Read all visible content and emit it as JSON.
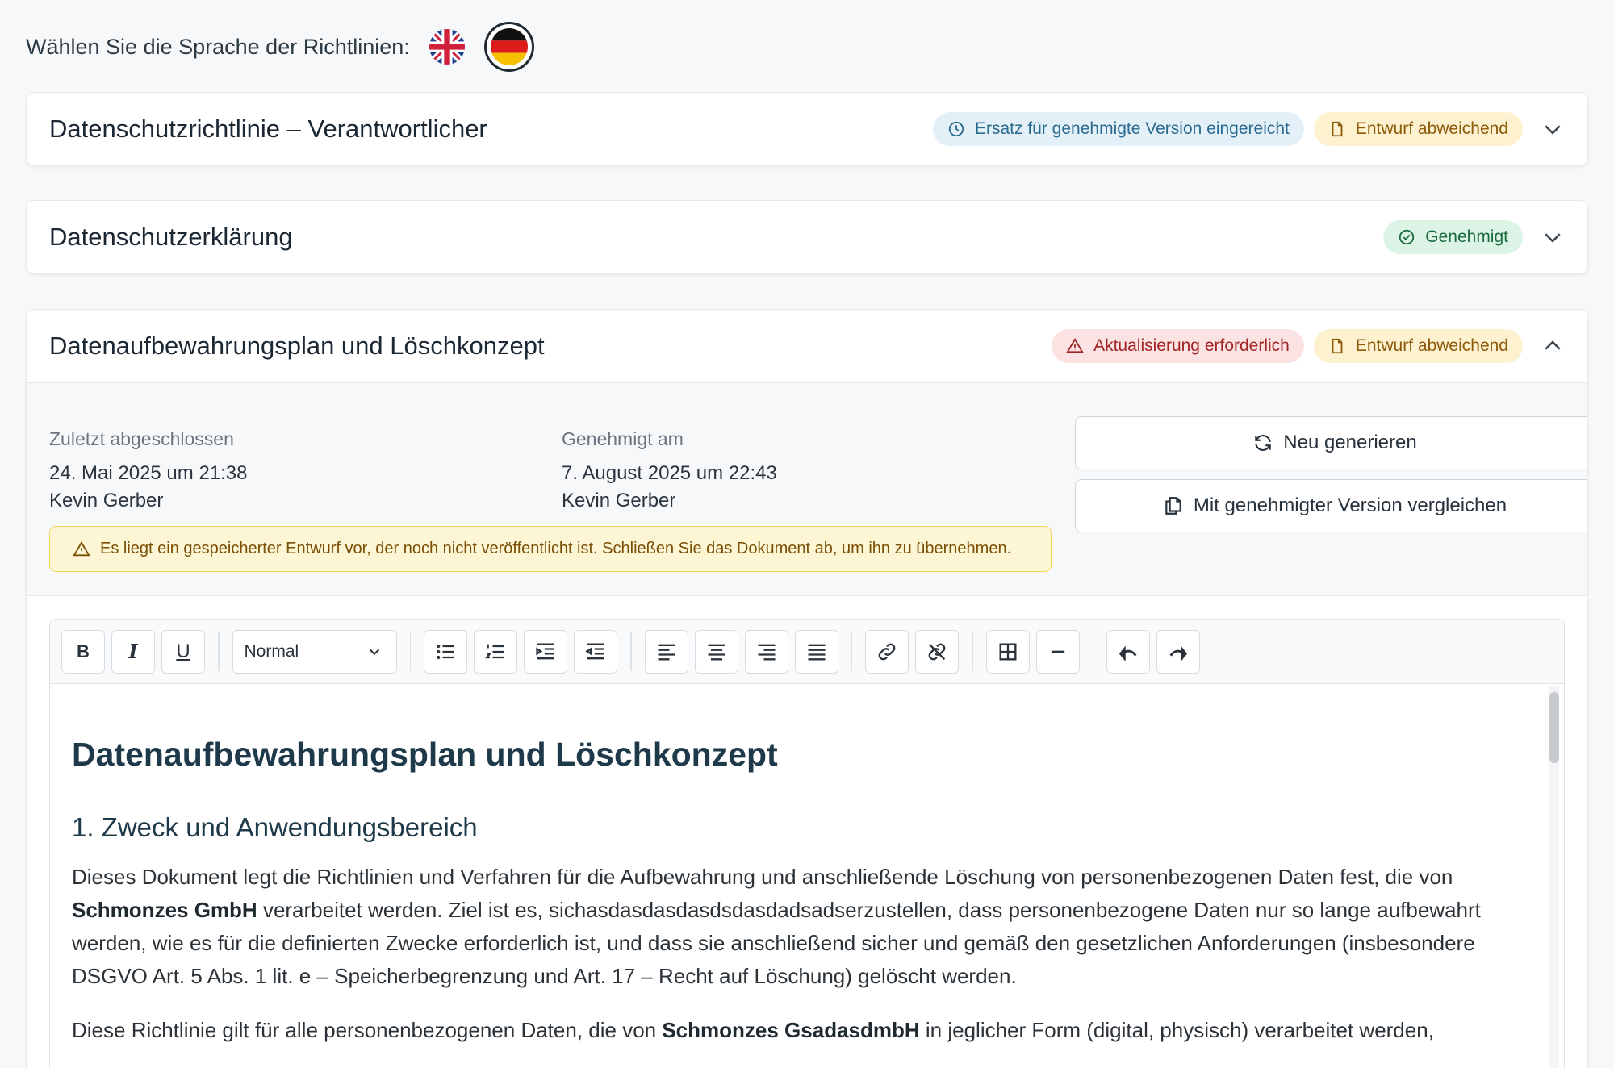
{
  "language": {
    "label": "Wählen Sie die Sprache der Richtlinien:",
    "options": [
      "English",
      "Deutsch"
    ],
    "selected": "Deutsch"
  },
  "cards": [
    {
      "title": "Datenschutzrichtlinie – Verantwortlicher",
      "badges": [
        {
          "label": "Ersatz für genehmigte Version eingereicht",
          "icon": "clock-icon",
          "color": "#2b6a8f"
        },
        {
          "label": "Entwurf abweichend",
          "icon": "document-icon",
          "color": "#8d5a0a"
        }
      ],
      "expanded": false
    },
    {
      "title": "Datenschutzerklärung",
      "badges": [
        {
          "label": "Genehmigt",
          "icon": "check-circle-icon",
          "color": "#1c6b3f"
        }
      ],
      "expanded": false
    },
    {
      "title": "Datenaufbewahrungsplan und Löschkonzept",
      "badges": [
        {
          "label": "Aktualisierung erforderlich",
          "icon": "warning-icon",
          "color": "#a32424"
        },
        {
          "label": "Entwurf abweichend",
          "icon": "document-icon",
          "color": "#8d5a0a"
        }
      ],
      "expanded": true
    }
  ],
  "details": {
    "last_completed_label": "Zuletzt abgeschlossen",
    "last_completed_date": "24. Mai 2025 um 21:38",
    "last_completed_user": "Kevin Gerber",
    "approved_label": "Genehmigt am",
    "approved_date": "7. August 2025 um 22:43",
    "approved_user": "Kevin Gerber",
    "regenerate_label": "Neu generieren",
    "compare_label": "Mit genehmigter Version vergleichen",
    "draft_warning": "Es liegt ein gespeicherter Entwurf vor, der noch nicht veröffentlicht ist. Schließen Sie das Dokument ab, um ihn zu übernehmen."
  },
  "toolbar": {
    "bold": "B",
    "italic": "I",
    "underline": "U",
    "format_value": "Normal"
  },
  "document": {
    "title": "Datenaufbewahrungsplan und Löschkonzept",
    "section1_heading": "1. Zweck und Anwendungsbereich",
    "p1_part1": "Dieses Dokument legt die Richtlinien und Verfahren für die Aufbewahrung und anschließende Löschung von personenbezogenen Daten fest, die von ",
    "p1_company": "Schmonzes GmbH",
    "p1_part2": " verarbeitet werden. Ziel ist es, sichasdasdasdasdsdasdadsadserzustellen, dass personenbezogene Daten nur so lange aufbewahrt werden, wie es für die definierten Zwecke erforderlich ist, und dass sie anschließend sicher und gemäß den gesetzlichen Anforderungen (insbesondere DSGVO Art. 5 Abs. 1 lit. e – Speicherbegrenzung und Art. 17 – Recht auf Löschung) gelöscht werden.",
    "p2_part1": "Diese Richtlinie gilt für alle personenbezogenen Daten, die von ",
    "p2_company": "Schmonzes GsadasdmbH",
    "p2_part2": " in jeglicher Form (digital, physisch) verarbeitet werden,"
  }
}
